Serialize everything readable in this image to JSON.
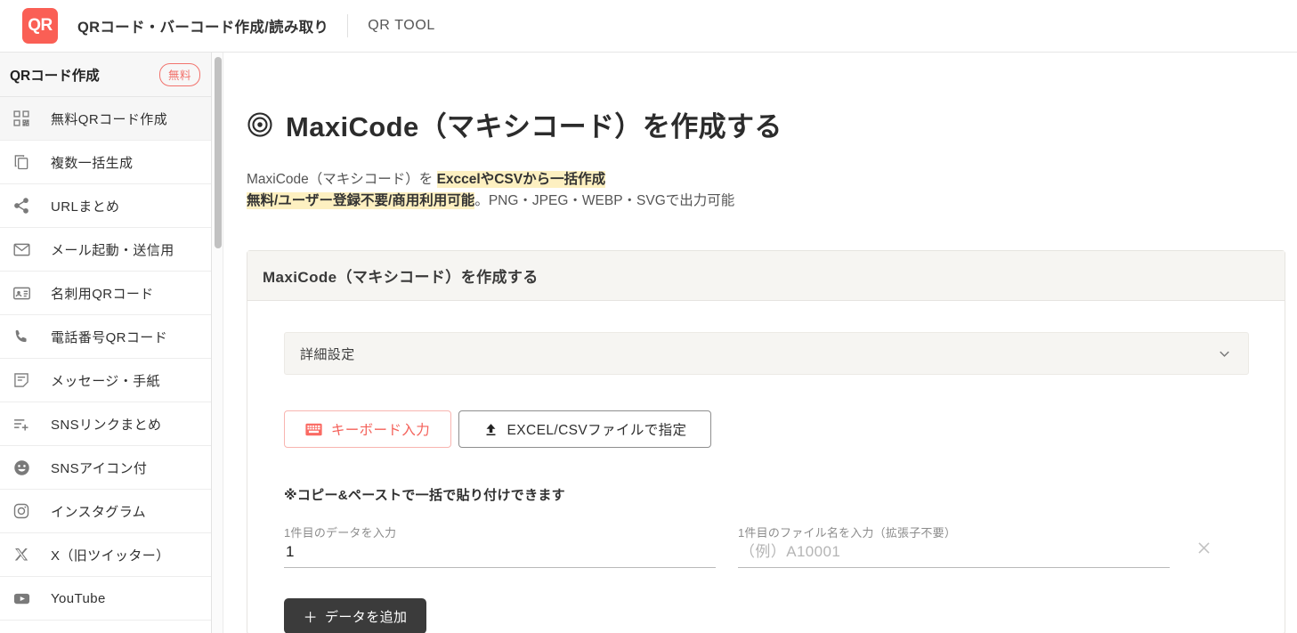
{
  "header": {
    "logo_text": "QR",
    "site_title": "QRコード・バーコード作成/読み取り",
    "nav_link": "QR TOOL"
  },
  "sidebar": {
    "heading": "QRコード作成",
    "badge": "無料",
    "items": [
      {
        "label": "無料QRコード作成",
        "icon": "qr-grid-icon",
        "active": true
      },
      {
        "label": "複数一括生成",
        "icon": "copy-icon",
        "active": false
      },
      {
        "label": "URLまとめ",
        "icon": "share-icon",
        "active": false
      },
      {
        "label": "メール起動・送信用",
        "icon": "mail-icon",
        "active": false
      },
      {
        "label": "名刺用QRコード",
        "icon": "contact-card-icon",
        "active": false
      },
      {
        "label": "電話番号QRコード",
        "icon": "phone-icon",
        "active": false
      },
      {
        "label": "メッセージ・手紙",
        "icon": "note-icon",
        "active": false
      },
      {
        "label": "SNSリンクまとめ",
        "icon": "list-plus-icon",
        "active": false
      },
      {
        "label": "SNSアイコン付",
        "icon": "smiley-icon",
        "active": false
      },
      {
        "label": "インスタグラム",
        "icon": "instagram-icon",
        "active": false
      },
      {
        "label": "X（旧ツイッター）",
        "icon": "x-twitter-icon",
        "active": false
      },
      {
        "label": "YouTube",
        "icon": "youtube-icon",
        "active": false
      }
    ]
  },
  "main": {
    "page_title": "MaxiCode（マキシコード）を作成する",
    "lead_line1_plain": "MaxiCode（マキシコード）を ",
    "lead_line1_highlight": "ExccelやCSVから一括作成",
    "lead_line2_highlight": "無料/ユーザー登録不要/商用利用可能",
    "lead_line2_plain": "。PNG・JPEG・WEBP・SVGで出力可能",
    "card": {
      "title": "MaxiCode（マキシコード）を作成する",
      "accordion_label": "詳細設定",
      "buttons": {
        "keyboard": "キーボード入力",
        "file": "EXCEL/CSVファイルで指定"
      },
      "paste_note": "※コピー&ペーストで一括で貼り付けできます",
      "field_data_label": "1件目のデータを入力",
      "field_data_value": "1",
      "field_data_placeholder": "",
      "field_name_label": "1件目のファイル名を入力（拡張子不要）",
      "field_name_value": "",
      "field_name_placeholder": "（例）A10001",
      "add_button": "データを追加",
      "add_button_plus": "＋"
    }
  },
  "colors": {
    "brand": "#fa5f55",
    "accent_red": "#f4615a",
    "highlight_yellow": "#fdf0c1",
    "dark_button": "#3b3b3b"
  }
}
